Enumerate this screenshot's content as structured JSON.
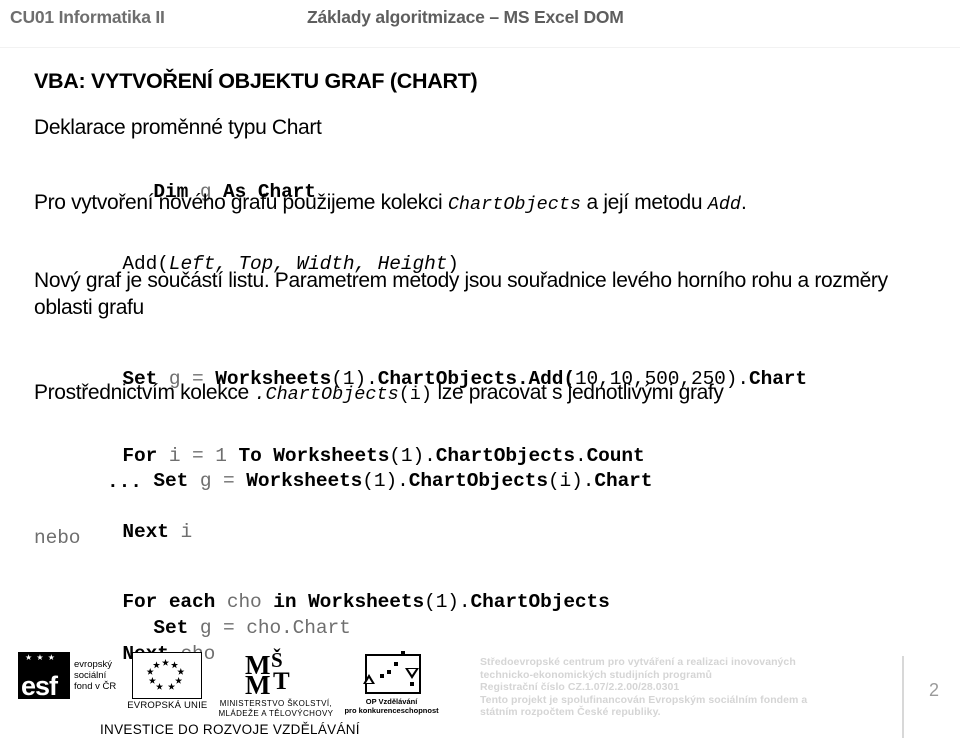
{
  "header": {
    "left": "CU01 Informatika II",
    "center": "Základy algoritmizace – MS Excel DOM"
  },
  "slide": {
    "title": "VBA: VYTVOŘENÍ OBJEKTU GRAF (CHART)",
    "lines": [
      {
        "id": "l1",
        "kind": "prose",
        "text": "Deklarace proměnné typu Chart"
      },
      {
        "id": "l2",
        "kind": "code",
        "parts": {
          "a": "Dim ",
          "b": "g",
          "c": " As Chart"
        }
      },
      {
        "id": "l3",
        "kind": "prose-mixed",
        "parts": {
          "a": "Pro vytvoření nového grafu použijeme kolekci ",
          "b": "ChartObjects",
          "c": " a její metodu ",
          "d": "Add",
          "e": "."
        }
      },
      {
        "id": "l4",
        "kind": "code",
        "parts": {
          "a": "Add(",
          "b": "Left, Top, Width, Height",
          "c": ")"
        }
      },
      {
        "id": "l5",
        "kind": "prose",
        "text": "Nový graf je součástí listu. Parametrem metody jsou souřadnice levého horního rohu a rozměry oblasti grafu"
      },
      {
        "id": "l6",
        "kind": "code",
        "parts": {
          "a": "Set ",
          "b": "g = ",
          "c": "Worksheets",
          "d": "(1).",
          "e": "ChartObjects.Add(",
          "f": "10,10,500,250",
          "g": ").",
          "h": "Chart"
        }
      },
      {
        "id": "l7",
        "kind": "prose-mixed",
        "parts": {
          "a": "Prostřednictvím kolekce ",
          "b": ".ChartObjects",
          "c": "(i)",
          "d": " lze pracovat s jednotlivými grafy"
        }
      },
      {
        "id": "l8",
        "kind": "code",
        "parts": {
          "a": "For ",
          "b": "i = 1 ",
          "c": "To Worksheets",
          "d": "(1).",
          "e": "ChartObjects",
          "f": ".",
          "g": "Count"
        }
      },
      {
        "id": "l9",
        "kind": "code",
        "parts": {
          "a": "Set ",
          "b": "g = ",
          "c": "Worksheets",
          "d": "(1).",
          "e": "ChartObjects",
          "f": "(i).",
          "g": "Chart"
        }
      },
      {
        "id": "l10",
        "kind": "code",
        "text": "..."
      },
      {
        "id": "l11",
        "kind": "code",
        "parts": {
          "a": "Next ",
          "b": "i"
        }
      },
      {
        "id": "l12",
        "kind": "code-gray",
        "text": "nebo"
      },
      {
        "id": "l13",
        "kind": "code",
        "parts": {
          "a": "For each ",
          "b": "cho ",
          "c": "in Worksheets",
          "d": "(1).",
          "e": "ChartObjects"
        }
      },
      {
        "id": "l14",
        "kind": "code",
        "parts": {
          "a": "Set ",
          "b": "g = cho.Chart"
        }
      },
      {
        "id": "l15",
        "kind": "code",
        "parts": {
          "a": "Next ",
          "b": "cho"
        }
      }
    ]
  },
  "footer": {
    "logos": {
      "esf": {
        "stars": "★ ★ ★",
        "wordmark": "esf",
        "line1": "evropský",
        "line2": "sociální",
        "line3": "fond v ČR"
      },
      "eu": {
        "caption": "EVROPSKÁ UNIE"
      },
      "msmt": {
        "m1": "M",
        "s1": "Š",
        "m2": "M",
        "t1": "T",
        "caption1": "MINISTERSTVO ŠKOLSTVÍ,",
        "caption2": "MLÁDEŽE A TĚLOVÝCHOVY"
      },
      "opvk": {
        "caption1": "OP Vzdělávání",
        "caption2": "pro konkurenceschopnost"
      }
    },
    "investment_line": "INVESTICE DO ROZVOJE VZDĚLÁVÁNÍ",
    "note": [
      "Středoevropské centrum pro vytváření a realizaci inovovaných",
      "technicko-ekonomických studijních programů",
      "Registrační číslo CZ.1.07/2.2.00/28.0301",
      "Tento projekt je spolufinancován Evropským sociálním fondem a",
      "státním rozpočtem České republiky."
    ],
    "page_number": "2"
  },
  "colors": {
    "header_text": "#6e6e6e",
    "body_text": "#000000",
    "gray_code": "#6f6f6f",
    "footer_note": "#d5d5d5",
    "rule": "#f2f2f2"
  }
}
